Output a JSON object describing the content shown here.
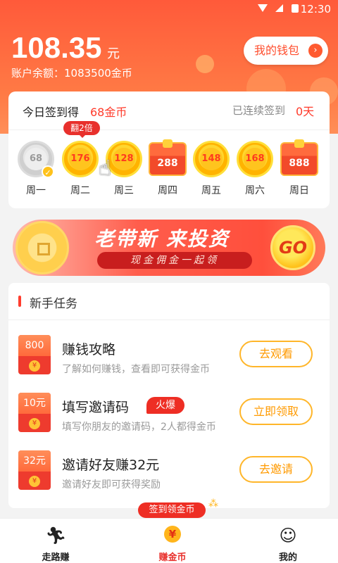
{
  "status_bar": {
    "time": "12:30"
  },
  "header": {
    "balance": "108.35",
    "balance_unit": "元",
    "account_label": "账户余额：1083500金币",
    "wallet_button": "我的钱包"
  },
  "signin": {
    "title": "今日签到得",
    "coins": "68金币",
    "streak_label": "已连续签到",
    "streak_value": "0天",
    "double_badge": "翻2倍",
    "days": [
      {
        "label": "周一",
        "value": "68",
        "kind": "done"
      },
      {
        "label": "周二",
        "value": "176",
        "kind": "coin"
      },
      {
        "label": "周三",
        "value": "128",
        "kind": "coin"
      },
      {
        "label": "周四",
        "value": "288",
        "kind": "chest"
      },
      {
        "label": "周五",
        "value": "148",
        "kind": "coin"
      },
      {
        "label": "周六",
        "value": "168",
        "kind": "coin"
      },
      {
        "label": "周日",
        "value": "888",
        "kind": "chest"
      }
    ]
  },
  "banner": {
    "title": "老带新  来投资",
    "subtitle": "现金佣金一起领",
    "go_label": "GO"
  },
  "tasks": {
    "section_title": "新手任务",
    "items": [
      {
        "envelope_value": "800",
        "title": "赚钱攻略",
        "desc": "了解如何赚钱，查看即可获得金币",
        "button": "去观看"
      },
      {
        "envelope_value": "10元",
        "title": "填写邀请码",
        "hot": "火爆",
        "desc": "填写你朋友的邀请码，2人都得金币",
        "button": "立即领取"
      },
      {
        "envelope_value": "32元",
        "title": "邀请好友赚32元",
        "desc": "邀请好友即可获得奖励",
        "button": "去邀请"
      }
    ]
  },
  "bottom_nav": {
    "bubble": "签到领金币",
    "items": [
      {
        "label": "走路赚",
        "icon": "runner-icon"
      },
      {
        "label": "赚金币",
        "icon": "yen-coin-icon"
      },
      {
        "label": "我的",
        "icon": "user-icon"
      }
    ]
  },
  "colors": {
    "accent": "#ff5a3a",
    "red": "#e8302c",
    "gold": "#ffb62a"
  }
}
